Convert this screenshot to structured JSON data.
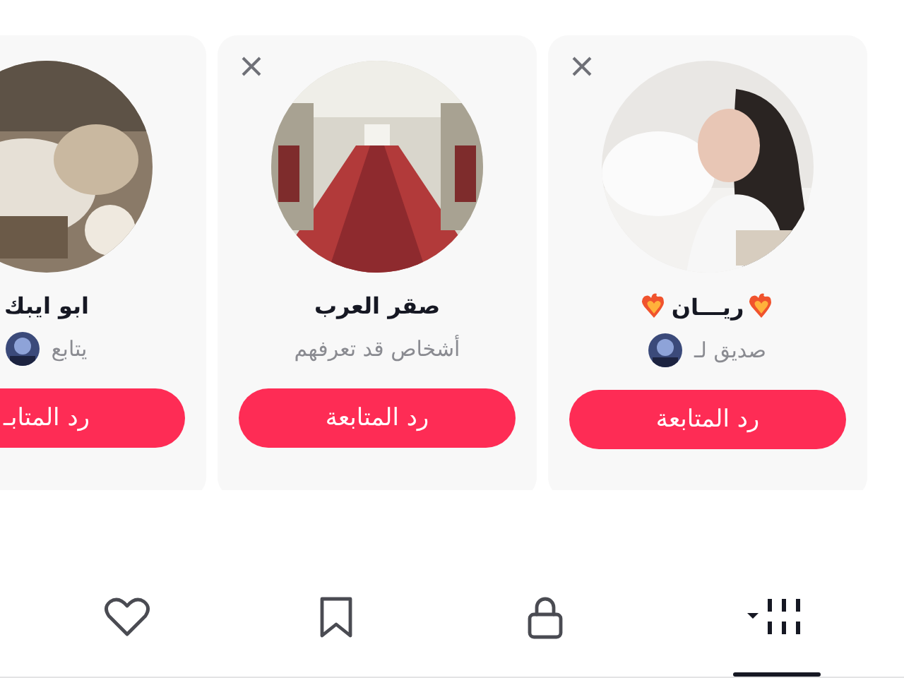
{
  "suggestions": [
    {
      "name": "ريـــان",
      "flame_hearts": true,
      "subtitle": "صديق لـ",
      "mutual_avatar": true,
      "dismissible": true,
      "button": "رد المتابعة"
    },
    {
      "name": "صقر العرب",
      "flame_hearts": false,
      "subtitle": "أشخاص قد تعرفهم",
      "mutual_avatar": false,
      "dismissible": true,
      "button": "رد المتابعة"
    },
    {
      "name": "ابو ايبك",
      "flame_hearts": false,
      "subtitle": "يتابع",
      "mutual_avatar": true,
      "dismissible": false,
      "button": "رد المتابـ"
    }
  ],
  "tabs": [
    {
      "kind": "videos",
      "selected": true
    },
    {
      "kind": "private",
      "selected": false
    },
    {
      "kind": "favorites",
      "selected": false
    },
    {
      "kind": "liked",
      "selected": false
    }
  ]
}
